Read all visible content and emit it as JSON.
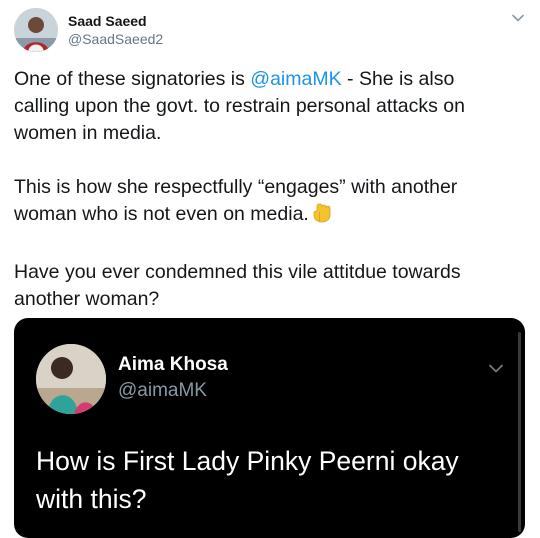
{
  "tweet": {
    "author_name": "Saad Saeed",
    "author_handle": "@SaadSaeed2",
    "menu_icon": "chevron-down-icon",
    "body": {
      "p1_line1_prefix": "One of these signatories is ",
      "p1_mention": "@aimaMK",
      "p1_line1_suffix": " - She is also",
      "p1_line2": "calling upon the govt. to restrain personal attacks on",
      "p1_line3": "women in media.",
      "p2_line1": "This is how she respectfully “engages” with another",
      "p2_line2": "woman who is not even on media.",
      "p2_emoji": "backhand-index-pointing-down-icon",
      "p3_line1": "Have you ever condemned this vile attitdue towards",
      "p3_line2": "another woman?"
    }
  },
  "embedded_screenshot": {
    "author_name": "Aima Khosa",
    "author_handle": "@aimaMK",
    "menu_icon": "chevron-down-icon",
    "text_line1": "How is First Lady Pinky Peerni okay",
    "text_line2": "with this?"
  },
  "colors": {
    "link": "#1b95e0",
    "secondary_text": "#657786",
    "embed_background": "#000000"
  }
}
